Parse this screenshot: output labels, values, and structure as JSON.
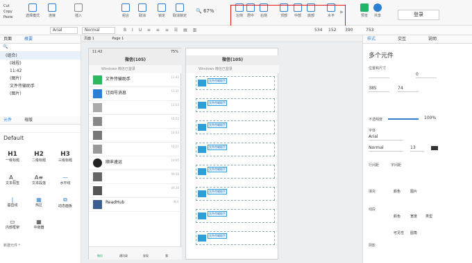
{
  "toolbar": {
    "clipboard": [
      "Cut",
      "Copy",
      "Paste"
    ],
    "left_buttons": [
      "选择模式",
      "连接",
      "插入"
    ],
    "mid_buttons": [
      "组合",
      "取消",
      "锁定",
      "取消锁定"
    ],
    "zoom": "67%",
    "align_buttons": [
      "左侧",
      "居中",
      "右侧",
      "顶部",
      "中部",
      "底部",
      "水平"
    ],
    "preview": "预览",
    "share": "共享",
    "login": "登录"
  },
  "format": {
    "font": "Arial",
    "style": "Normal",
    "x": "534",
    "y": "152",
    "w": "390",
    "h": "753"
  },
  "left_panel": {
    "tabs": [
      "页面",
      "概要"
    ],
    "tree": [
      "(组合)",
      "(线段)",
      "11:42",
      "(图片)",
      "文件传输助手",
      "(图片)"
    ],
    "lib_tabs": [
      "元件",
      "母版"
    ],
    "library": "Default",
    "widgets": [
      "一级标题",
      "二级标题",
      "三级标题",
      "文本标签",
      "文本段落",
      "水平线",
      "垂直线",
      "热区",
      "动态面板",
      "内部框架",
      "中继器"
    ],
    "widget_glyphs": [
      "H1",
      "H2",
      "H3",
      "A_",
      "A≡",
      "—",
      "|",
      "▦",
      "⧉",
      "▭",
      "▦"
    ],
    "footer": "新建元件 *"
  },
  "canvas": {
    "tabs": [
      "页面 1",
      "Page 1"
    ],
    "wechat_title": "微信(105)",
    "search_hint": "Windows 微信已登录",
    "chats": [
      {
        "name": "文件传输助手",
        "msg": "",
        "time": "11:42"
      },
      {
        "name": "订阅号消息",
        "msg": "",
        "time": "11:31"
      },
      {
        "name": "",
        "msg": "",
        "time": "11:03"
      },
      {
        "name": "",
        "msg": "",
        "time": "10:52"
      },
      {
        "name": "",
        "msg": "",
        "time": "10:43"
      },
      {
        "name": "",
        "msg": "",
        "time": "10:21"
      },
      {
        "name": "顺丰速运",
        "msg": "",
        "time": "10:05"
      },
      {
        "name": "",
        "msg": "",
        "time": "09:58"
      },
      {
        "name": "",
        "msg": "",
        "time": "09:30"
      },
      {
        "name": "ReadHub",
        "msg": "",
        "time": "昨天"
      }
    ],
    "bottom_nav": [
      "微信",
      "通讯录",
      "发现",
      "我"
    ],
    "status_left": "11:42",
    "status_right": "75%",
    "card_label": "文件传输助手",
    "right_phone_title": "微信(105)",
    "right_search": "Windows 微信已登录"
  },
  "right_panel": {
    "tabs": [
      "样式",
      "交互",
      "说明"
    ],
    "title": "多个元件",
    "size_label": "位置和尺寸",
    "x": "0",
    "w": "385",
    "h": "74",
    "opacity_label": "不透明度",
    "opacity": "100%",
    "font_label": "字体",
    "font": "Arial",
    "style": "Normal",
    "size": "13",
    "line_spacing": "行间距",
    "char_spacing": "字间距",
    "fill_label": "填充",
    "line_label": "线段",
    "shadow_label": "阴影",
    "fill_opts": [
      "颜色",
      "图片"
    ],
    "line_opts": [
      "颜色",
      "宽度",
      "类型"
    ],
    "corner_opts": [
      "可见性",
      "圆角"
    ]
  }
}
